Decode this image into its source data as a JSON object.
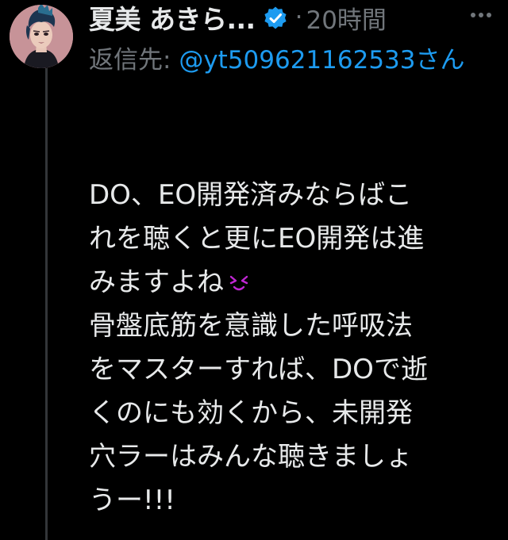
{
  "tweet": {
    "author": {
      "display_name": "夏美 あきら...",
      "verified": true,
      "avatar": "avatar-punk-portrait"
    },
    "separator": "·",
    "time_ago": "20時間",
    "reply_prefix": "返信先:",
    "reply_to": "@yt509621162533",
    "reply_suffix": "さん",
    "text_lines": [
      "DO、EO開発済みならばこ",
      "れを聴くと更にEO開発は進",
      "みますよね",
      "骨盤底筋を意識した呼吸法",
      "をマスターすれば、DOで逝",
      "くのにも効くから、未開発",
      "穴ラーはみんな聴きましょ",
      "うー!!!"
    ],
    "emoji": "smirking-heart-face-icon"
  },
  "colors": {
    "background": "#000000",
    "text": "#e7e9ea",
    "muted": "#71767b",
    "link": "#1d9bf0",
    "verified": "#1d9bf0",
    "emoji": "#c026d3",
    "thread_line": "#333639"
  }
}
